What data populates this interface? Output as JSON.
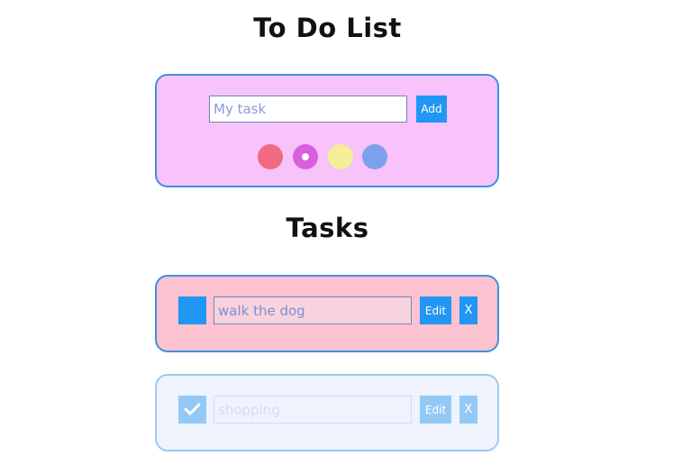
{
  "header": {
    "title": "To Do List"
  },
  "new_task": {
    "input_placeholder": "My task",
    "add_label": "Add",
    "colors": [
      {
        "name": "red",
        "hex": "#f06a82",
        "selected": false
      },
      {
        "name": "magenta",
        "hex": "#d95ee0",
        "selected": true
      },
      {
        "name": "yellow",
        "hex": "#f5f097",
        "selected": false
      },
      {
        "name": "blue",
        "hex": "#7ca0ec",
        "selected": false
      }
    ]
  },
  "tasks_section": {
    "title": "Tasks"
  },
  "tasks": [
    {
      "text": "walk the dog",
      "completed": false,
      "color": "#fcc2d0",
      "edit_label": "Edit",
      "delete_label": "X"
    },
    {
      "text": "shopping",
      "completed": true,
      "color": "#eef3fd",
      "edit_label": "Edit",
      "delete_label": "X"
    }
  ],
  "icons": {
    "checkmark": "checkmark-icon"
  }
}
